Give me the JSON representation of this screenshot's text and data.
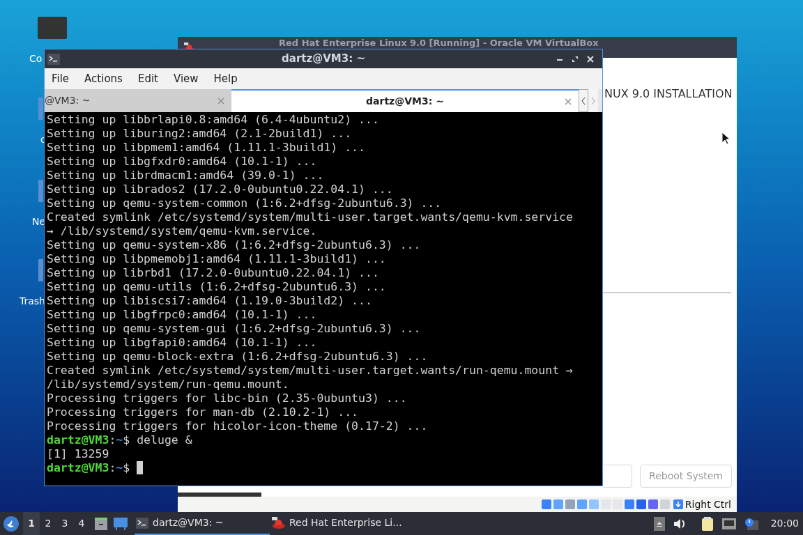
{
  "desktop_icons": [
    {
      "label": "Co"
    },
    {
      "label": "c"
    },
    {
      "label": "Ne"
    },
    {
      "label": "Trash"
    }
  ],
  "vbox": {
    "title": "Red Hat Enterprise Linux 9.0 [Running] - Oracle VM VirtualBox",
    "heading": "NUX 9.0 INSTALLATION",
    "buttons": [
      {
        "kind": "blank"
      },
      {
        "kind": "labeled",
        "label": "Reboot System",
        "disabled": true
      }
    ],
    "host_key": "Right Ctrl"
  },
  "terminal": {
    "title": "dartz@VM3: ~",
    "menu": [
      "File",
      "Actions",
      "Edit",
      "View",
      "Help"
    ],
    "tabs": [
      {
        "label": "@VM3: ~",
        "selected": false
      },
      {
        "label": "dartz@VM3: ~",
        "selected": true
      }
    ],
    "lines": [
      {
        "kind": "output",
        "text": "Setting up libbrlapi0.8:amd64 (6.4-4ubuntu2) ..."
      },
      {
        "kind": "output",
        "text": "Setting up liburing2:amd64 (2.1-2build1) ..."
      },
      {
        "kind": "output",
        "text": "Setting up libpmem1:amd64 (1.11.1-3build1) ..."
      },
      {
        "kind": "output",
        "text": "Setting up libgfxdr0:amd64 (10.1-1) ..."
      },
      {
        "kind": "output",
        "text": "Setting up librdmacm1:amd64 (39.0-1) ..."
      },
      {
        "kind": "output",
        "text": "Setting up librados2 (17.2.0-0ubuntu0.22.04.1) ..."
      },
      {
        "kind": "output",
        "text": "Setting up qemu-system-common (1:6.2+dfsg-2ubuntu6.3) ..."
      },
      {
        "kind": "output",
        "text": "Created symlink /etc/systemd/system/multi-user.target.wants/qemu-kvm.service"
      },
      {
        "kind": "output",
        "text": "→ /lib/systemd/system/qemu-kvm.service."
      },
      {
        "kind": "output",
        "text": "Setting up qemu-system-x86 (1:6.2+dfsg-2ubuntu6.3) ..."
      },
      {
        "kind": "output",
        "text": "Setting up libpmemobj1:amd64 (1.11.1-3build1) ..."
      },
      {
        "kind": "output",
        "text": "Setting up librbd1 (17.2.0-0ubuntu0.22.04.1) ..."
      },
      {
        "kind": "output",
        "text": "Setting up qemu-utils (1:6.2+dfsg-2ubuntu6.3) ..."
      },
      {
        "kind": "output",
        "text": "Setting up libiscsi7:amd64 (1.19.0-3build2) ..."
      },
      {
        "kind": "output",
        "text": "Setting up libgfrpc0:amd64 (10.1-1) ..."
      },
      {
        "kind": "output",
        "text": "Setting up qemu-system-gui (1:6.2+dfsg-2ubuntu6.3) ..."
      },
      {
        "kind": "output",
        "text": "Setting up libgfapi0:amd64 (10.1-1) ..."
      },
      {
        "kind": "output",
        "text": "Setting up qemu-block-extra (1:6.2+dfsg-2ubuntu6.3) ..."
      },
      {
        "kind": "output",
        "text": "Created symlink /etc/systemd/system/multi-user.target.wants/run-qemu.mount →"
      },
      {
        "kind": "output",
        "text": "/lib/systemd/system/run-qemu.mount."
      },
      {
        "kind": "output",
        "text": "Processing triggers for libc-bin (2.35-0ubuntu3) ..."
      },
      {
        "kind": "output",
        "text": "Processing triggers for man-db (2.10.2-1) ..."
      },
      {
        "kind": "output",
        "text": "Processing triggers for hicolor-icon-theme (0.17-2) ..."
      },
      {
        "kind": "prompt",
        "host": "dartz@VM3",
        "sep": ":",
        "path": "~",
        "sign": "$",
        "command": " deluge &"
      },
      {
        "kind": "output",
        "text": "[1] 13259"
      },
      {
        "kind": "prompt",
        "host": "dartz@VM3",
        "sep": ":",
        "path": "~",
        "sign": "$",
        "cursor": true
      }
    ]
  },
  "taskbar": {
    "workspaces": [
      {
        "label": "1",
        "selected": true
      },
      {
        "label": "2",
        "selected": false
      },
      {
        "label": "3",
        "selected": false
      },
      {
        "label": "4",
        "selected": false
      }
    ],
    "tasks": [
      {
        "label": "dartz@VM3: ~",
        "selected": true,
        "kind": "terminal"
      },
      {
        "label": "Red Hat Enterprise Li...",
        "selected": false,
        "kind": "vbox"
      }
    ],
    "clock": "20:00"
  }
}
